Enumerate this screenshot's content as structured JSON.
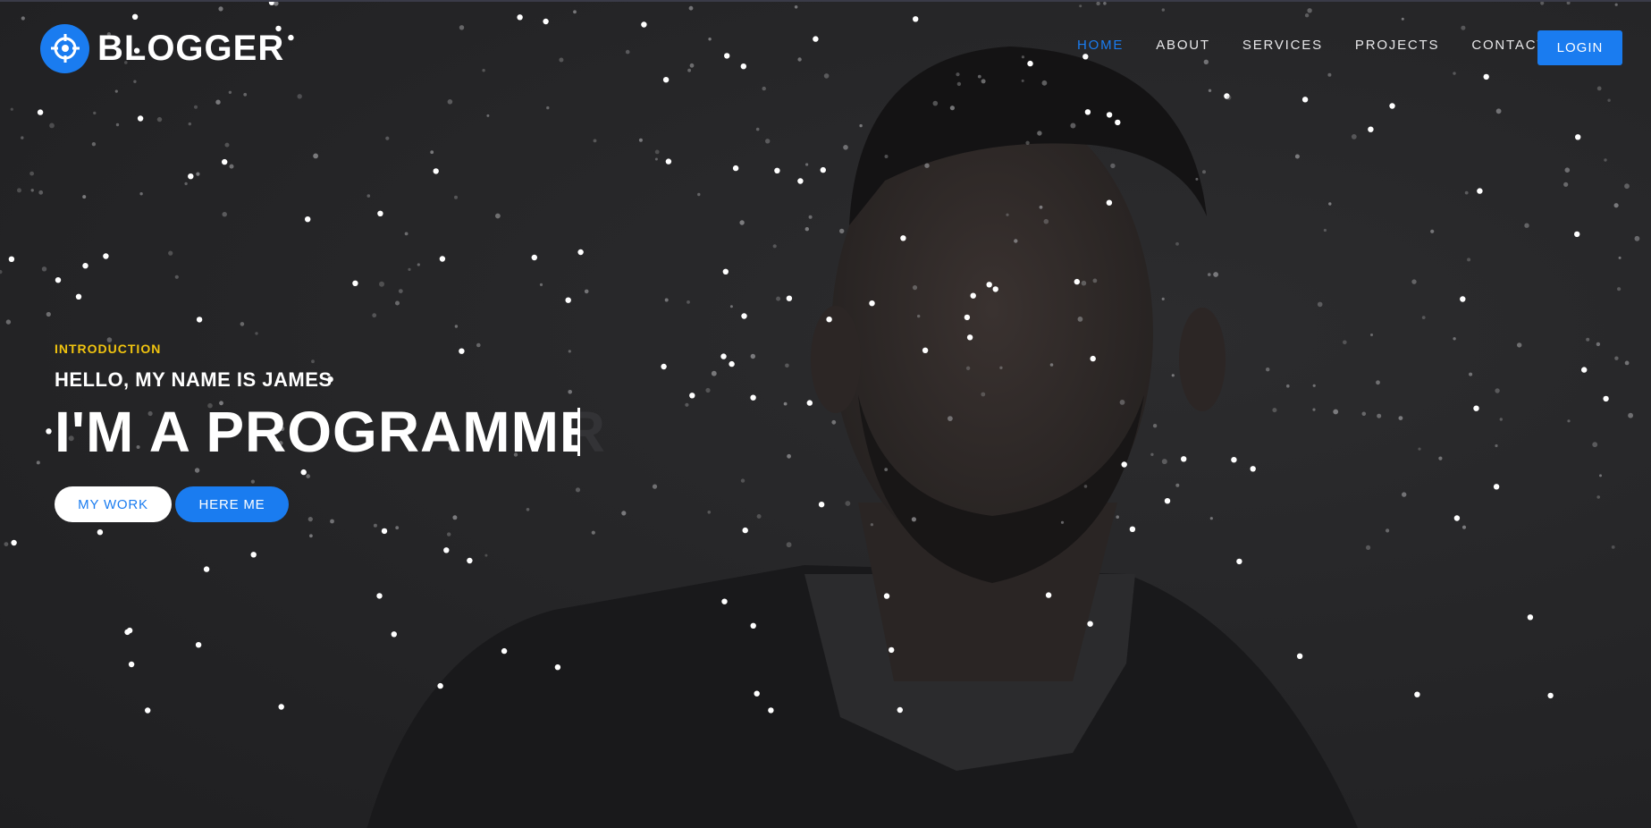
{
  "brand": {
    "name": "BLOGGER",
    "icon": "crosshair-icon",
    "accent_color": "#1a7cf0"
  },
  "nav": {
    "items": [
      {
        "label": "HOME",
        "active": true
      },
      {
        "label": "ABOUT",
        "active": false
      },
      {
        "label": "SERVICES",
        "active": false
      },
      {
        "label": "PROJECTS",
        "active": false
      },
      {
        "label": "CONTACT",
        "active": false
      }
    ],
    "login_label": "LOGIN"
  },
  "hero": {
    "eyebrow": "INTRODUCTION",
    "eyebrow_color": "#f1c40f",
    "subtitle": "HELLO, MY NAME IS JAMES",
    "headline": "I'M A PROGRAMMER",
    "buttons": {
      "my_work": "MY WORK",
      "here_me": "HERE ME"
    }
  }
}
